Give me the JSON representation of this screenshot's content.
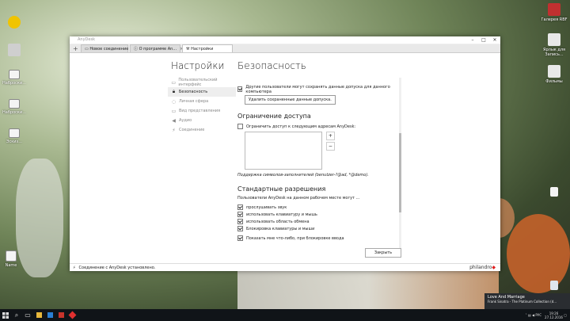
{
  "desktop": {
    "icons_left": [
      {
        "label": "",
        "color": "#f0c400"
      },
      {
        "label": "",
        "color": "#c8c8c8"
      },
      {
        "label": "Наброски...",
        "color": "#ffffff"
      },
      {
        "label": "Наброски...",
        "color": "#ffffff"
      },
      {
        "label": "Эскиз...",
        "color": "#ffffff"
      },
      {
        "label": "Name",
        "color": "#ffffff"
      }
    ],
    "icons_right": [
      {
        "label": "Галерея RBF",
        "color": "#c03030"
      },
      {
        "label": "Ярлык для Запись...",
        "color": "#dddddd"
      },
      {
        "label": "Фильмы",
        "color": "#dddddd"
      }
    ]
  },
  "window": {
    "app_title": "AnyDesk",
    "tabs": [
      {
        "label": "Новое соединение",
        "icon": "monitor-icon"
      },
      {
        "label": "О программе An...",
        "icon": "info-icon"
      },
      {
        "label": "Настройки",
        "icon": "wrench-icon"
      }
    ],
    "heading_left": "Настройки",
    "heading_right": "Безопасность",
    "sidebar": [
      {
        "label": "Пользовательский интерфейс",
        "icon": "window-icon"
      },
      {
        "label": "Безопасность",
        "icon": "lock-icon"
      },
      {
        "label": "Личная сфера",
        "icon": "bubble-icon"
      },
      {
        "label": "Вид представления",
        "icon": "monitor-icon"
      },
      {
        "label": "Аудио",
        "icon": "speaker-icon"
      },
      {
        "label": "Соединение",
        "icon": "plug-icon"
      }
    ],
    "security": {
      "save_credentials_label": "Другие пользователи могут сохранять данные допуска для данного компьютера",
      "delete_button": "Удалить сохраненные данные допуска.",
      "access_heading": "Ограничение доступа",
      "restrict_label": "Ограничить доступ к следующим адресам AnyDesk:",
      "plus": "+",
      "minus": "−",
      "wildcard_hint": "Поддержка символов-заполнителей (benutzer-?@ad, *@demo).",
      "permissions_heading": "Стандартные разрешения",
      "permissions_intro": "Пользователи AnyDesk на данном рабочем месте могут ...",
      "permissions": [
        {
          "label": "прослушивать звук",
          "checked": true
        },
        {
          "label": "использовать клавиатуру и мышь",
          "checked": true
        },
        {
          "label": "использовать область обмена",
          "checked": true
        },
        {
          "label": "Блокировка клавиатуры и мыши",
          "checked": true
        }
      ],
      "show_lock_label": "Показать мне что-либо, при блокировке ввода"
    },
    "close_button": "Закрыть",
    "status_text": "Соединение с AnyDesk установлено.",
    "brand": "philandro"
  },
  "notification": {
    "title": "Love And Marriage",
    "subtitle": "Frank Sinatra - The Platinum Collection (d..."
  },
  "taskbar": {
    "lang": "РУС",
    "time": "19:26",
    "date": "27.12.2016"
  }
}
